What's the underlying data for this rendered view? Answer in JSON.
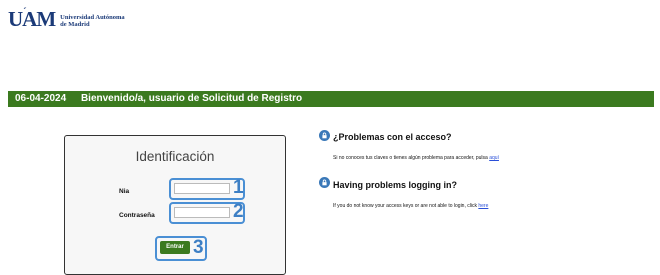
{
  "logo": {
    "mark": "UAM",
    "accent": "´",
    "line1": "Universidad Autónoma",
    "line2": "de Madrid"
  },
  "header_bar": {
    "date": "06-04-2024",
    "welcome": "Bienvenido/a, usuario de Solicitud de Registro"
  },
  "login": {
    "title": "Identificación",
    "nia_label": "Nia",
    "nia_value": "",
    "password_label": "Contraseña",
    "password_value": "",
    "submit_label": "Entrar",
    "annotations": [
      "1",
      "2",
      "3"
    ]
  },
  "help_es": {
    "title": "¿Problemas con el acceso?",
    "text": "Si no conoces tus claves o tienes algún problema para acceder, pulsa",
    "link": "aquí"
  },
  "help_en": {
    "title": "Having problems logging in?",
    "text": "If you do not know your access keys or are not able to login, click",
    "link": "here"
  },
  "colors": {
    "green": "#3b7a1f",
    "annotation_blue": "#4a8fd4",
    "brand_blue": "#1b3a78"
  }
}
